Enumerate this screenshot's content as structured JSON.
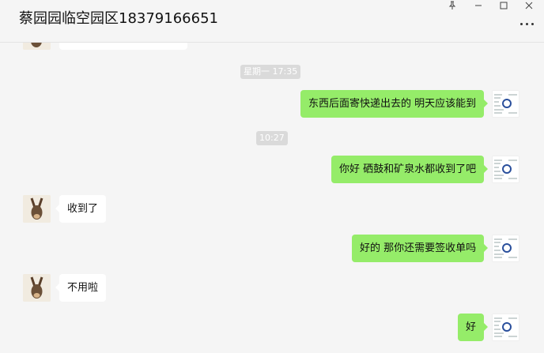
{
  "window": {
    "title": "蔡园园临空园区18379166651",
    "controls": [
      "pin-icon",
      "minimize-icon",
      "maximize-icon",
      "close-icon"
    ],
    "menu_icon": "more-icon"
  },
  "colors": {
    "background": "#f5f5f5",
    "my_bubble": "#95ec69",
    "their_bubble": "#ffffff",
    "timestamp_bg": "#dadada"
  },
  "chat": {
    "timestamps": [
      "星期一 17:35",
      "10:27"
    ],
    "messages": [
      {
        "from": "them",
        "text": ""
      },
      {
        "from": "me",
        "text": "东西后面寄快递出去的  明天应该能到"
      },
      {
        "from": "me",
        "text": "你好  硒鼓和矿泉水都收到了吧"
      },
      {
        "from": "them",
        "text": "收到了"
      },
      {
        "from": "me",
        "text": "好的  那你还需要签收单吗"
      },
      {
        "from": "them",
        "text": "不用啦"
      },
      {
        "from": "me",
        "text": "好"
      }
    ]
  }
}
